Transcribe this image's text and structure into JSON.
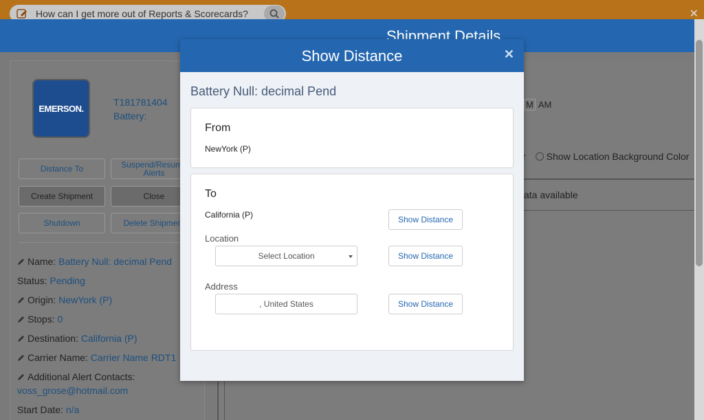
{
  "topbar": {
    "help_text": "How can I get more out of Reports & Scorecards?",
    "close_icon": "close-icon"
  },
  "header": {
    "title": "Shipment Details"
  },
  "left": {
    "logo_text": "EMERSON.",
    "tracker_id": "T181781404",
    "battery_label": "Battery:",
    "buttons": {
      "distance_to": "Distance To",
      "suspend": "Suspend/Resume Alerts",
      "create_shipment": "Create Shipment",
      "close": "Close",
      "shutdown": "Shutdown",
      "delete_shipment": "Delete Shipment"
    },
    "fields": {
      "name_label": "Name:",
      "name_value": "Battery Null: decimal Pend",
      "status_label": "Status:",
      "status_value": "Pending",
      "origin_label": "Origin:",
      "origin_value": "NewYork (P)",
      "stops_label": "Stops:",
      "stops_value": "0",
      "destination_label": "Destination:",
      "destination_value": "California (P)",
      "carrier_label": "Carrier Name:",
      "carrier_value": "Carrier Name RDT1",
      "contacts_label": "Additional Alert Contacts:",
      "contacts_value": "voss_grose@hotmail.com",
      "start_label": "Start Date:",
      "start_value": "n/a"
    }
  },
  "right": {
    "time_m": "M",
    "time_am": "AM",
    "loc_left": "r",
    "loc_bg_label": "Show Location Background Color",
    "data_text": "ata available"
  },
  "modal": {
    "title": "Show Distance",
    "subtitle": "Battery Null: decimal Pend",
    "from_heading": "From",
    "from_value": "NewYork (P)",
    "to_heading": "To",
    "to_value": "California (P)",
    "location_label": "Location",
    "location_select": "Select Location",
    "address_label": "Address",
    "address_value": ", United States",
    "show_distance_label": "Show Distance"
  }
}
